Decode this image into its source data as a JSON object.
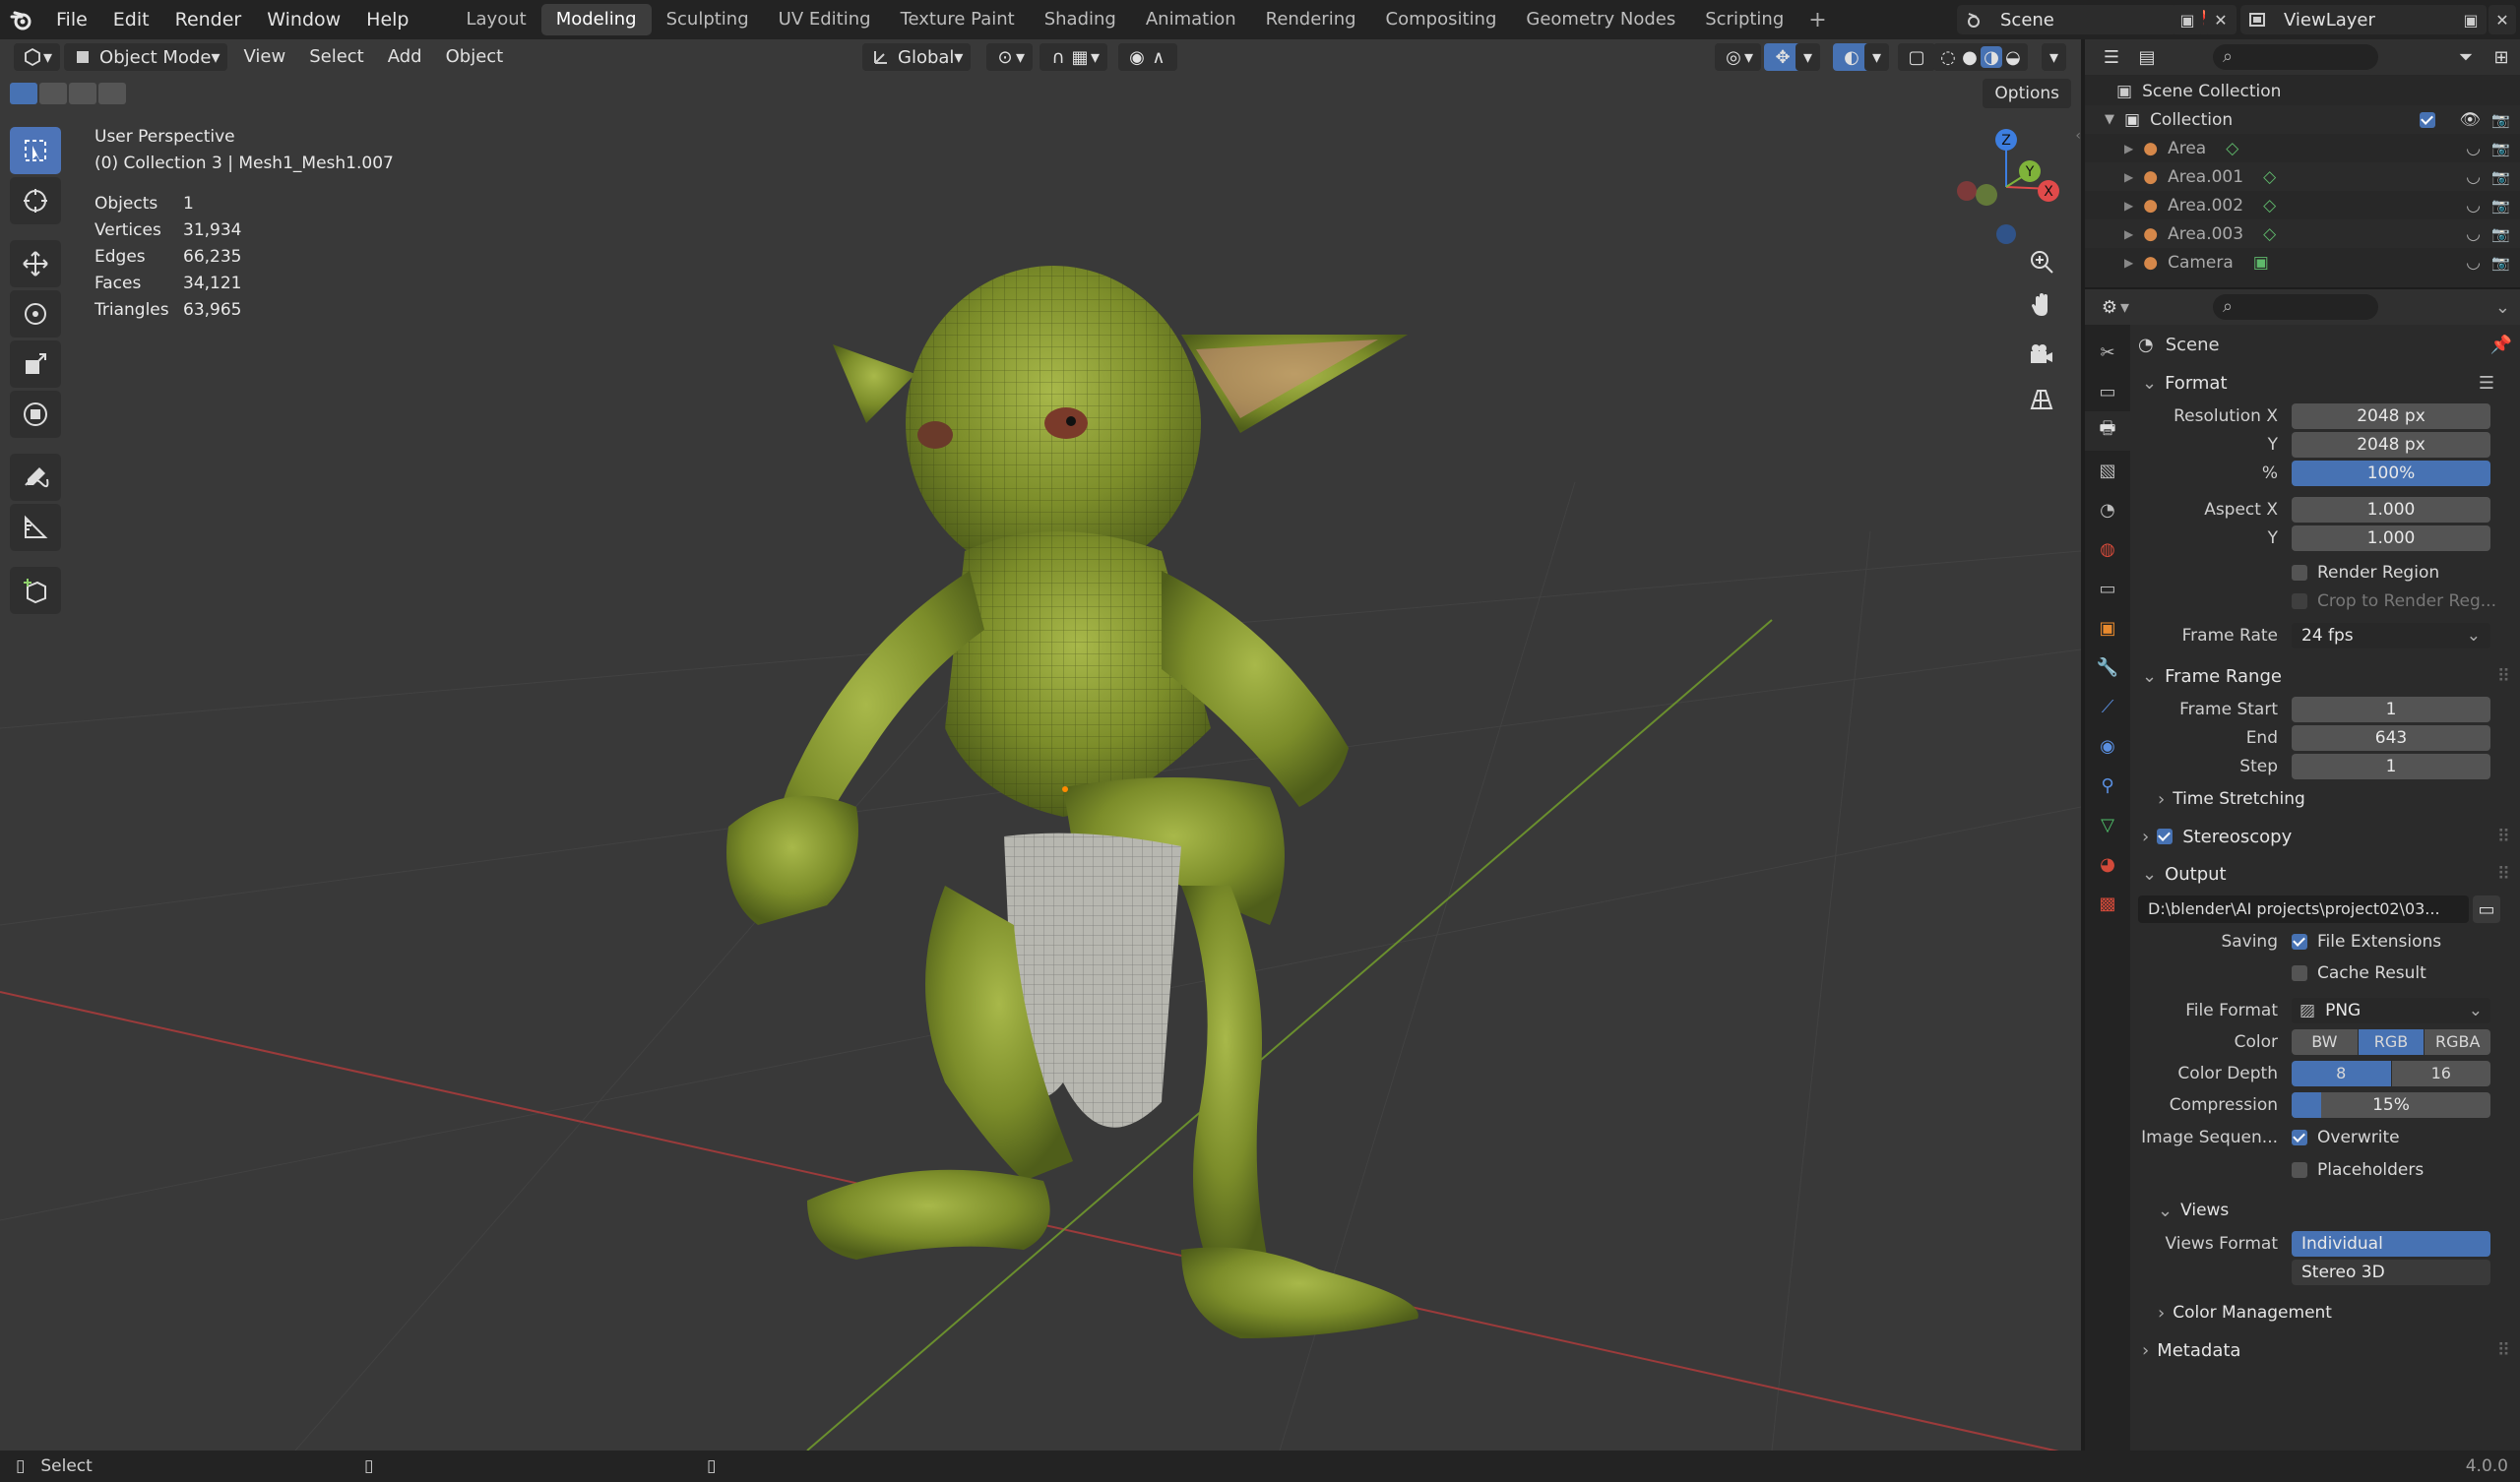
{
  "menu": [
    "File",
    "Edit",
    "Render",
    "Window",
    "Help"
  ],
  "workspaces": [
    "Layout",
    "Modeling",
    "Sculpting",
    "UV Editing",
    "Texture Paint",
    "Shading",
    "Animation",
    "Rendering",
    "Compositing",
    "Geometry Nodes",
    "Scripting"
  ],
  "active_workspace": "Modeling",
  "scene_name": "Scene",
  "view_layer": "ViewLayer",
  "viewport": {
    "mode": "Object Mode",
    "menus": [
      "View",
      "Select",
      "Add",
      "Object"
    ],
    "orientation": "Global",
    "options": "Options",
    "perspective": "User Perspective",
    "collection_info": "(0) Collection 3 | Mesh1_Mesh1.007",
    "stats": [
      {
        "label": "Objects",
        "value": "1"
      },
      {
        "label": "Vertices",
        "value": "31,934"
      },
      {
        "label": "Edges",
        "value": "66,235"
      },
      {
        "label": "Faces",
        "value": "34,121"
      },
      {
        "label": "Triangles",
        "value": "63,965"
      }
    ],
    "gizmo": {
      "x": "X",
      "y": "Y",
      "z": "Z"
    }
  },
  "outliner": {
    "root": "Scene Collection",
    "collection": "Collection",
    "items": [
      "Area",
      "Area.001",
      "Area.002",
      "Area.003",
      "Camera"
    ]
  },
  "properties": {
    "context": "Scene",
    "format": {
      "title": "Format",
      "resolution_x_label": "Resolution X",
      "resolution_x": "2048 px",
      "resolution_y_label": "Y",
      "resolution_y": "2048 px",
      "percent_label": "%",
      "percent": "100%",
      "aspect_x_label": "Aspect X",
      "aspect_x": "1.000",
      "aspect_y_label": "Y",
      "aspect_y": "1.000",
      "render_region": "Render Region",
      "crop": "Crop to Render Reg...",
      "frame_rate_label": "Frame Rate",
      "frame_rate": "24 fps"
    },
    "frame_range": {
      "title": "Frame Range",
      "start_label": "Frame Start",
      "start": "1",
      "end_label": "End",
      "end": "643",
      "step_label": "Step",
      "step": "1",
      "time_stretching": "Time Stretching"
    },
    "stereoscopy": "Stereoscopy",
    "output": {
      "title": "Output",
      "path": "D:\\blender\\AI projects\\project02\\03...",
      "saving_label": "Saving",
      "file_extensions": "File Extensions",
      "cache_result": "Cache Result",
      "file_format_label": "File Format",
      "file_format": "PNG",
      "color_label": "Color",
      "color_options": [
        "BW",
        "RGB",
        "RGBA"
      ],
      "color_selected": "RGB",
      "depth_label": "Color Depth",
      "depth_options": [
        "8",
        "16"
      ],
      "depth_selected": "8",
      "compression_label": "Compression",
      "compression": "15%",
      "image_seq_label": "Image Sequen...",
      "overwrite": "Overwrite",
      "placeholders": "Placeholders",
      "views": "Views",
      "views_format_label": "Views Format",
      "views_options": [
        "Individual",
        "Stereo 3D"
      ],
      "color_management": "Color Management"
    },
    "metadata": "Metadata"
  },
  "status": {
    "action": "Select",
    "version": "4.0.0"
  },
  "colors": {
    "accent": "#4772b3",
    "x_axis": "#e04a4a",
    "y_axis": "#7fb33a",
    "z_axis": "#3d7ee0",
    "viewport_bg": "#393939"
  }
}
